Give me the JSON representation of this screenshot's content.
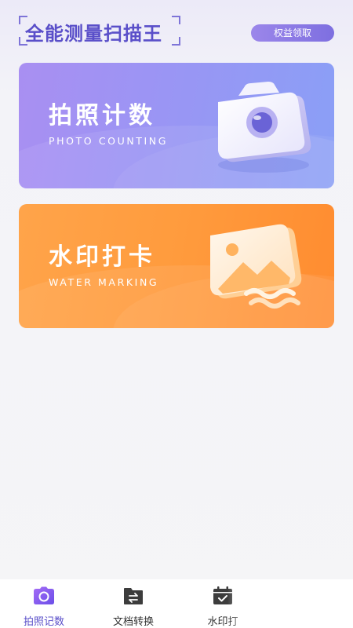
{
  "header": {
    "app_title": "全能测量扫描王",
    "benefit_button": "权益领取"
  },
  "cards": [
    {
      "title": "拍照计数",
      "subtitle": "PHOTO COUNTING",
      "icon": "camera-icon",
      "color": "#9a95f4"
    },
    {
      "title": "水印打卡",
      "subtitle": "WATER MARKING",
      "icon": "image-watermark-icon",
      "color": "#ff9b3d"
    }
  ],
  "bottom_nav": {
    "items": [
      {
        "label": "拍照记数",
        "icon": "camera-icon",
        "active": true
      },
      {
        "label": "文档转换",
        "icon": "folder-convert-icon",
        "active": false
      },
      {
        "label": "水印打",
        "icon": "calendar-check-icon",
        "active": false
      }
    ],
    "active_color": "#7b5cf0"
  }
}
